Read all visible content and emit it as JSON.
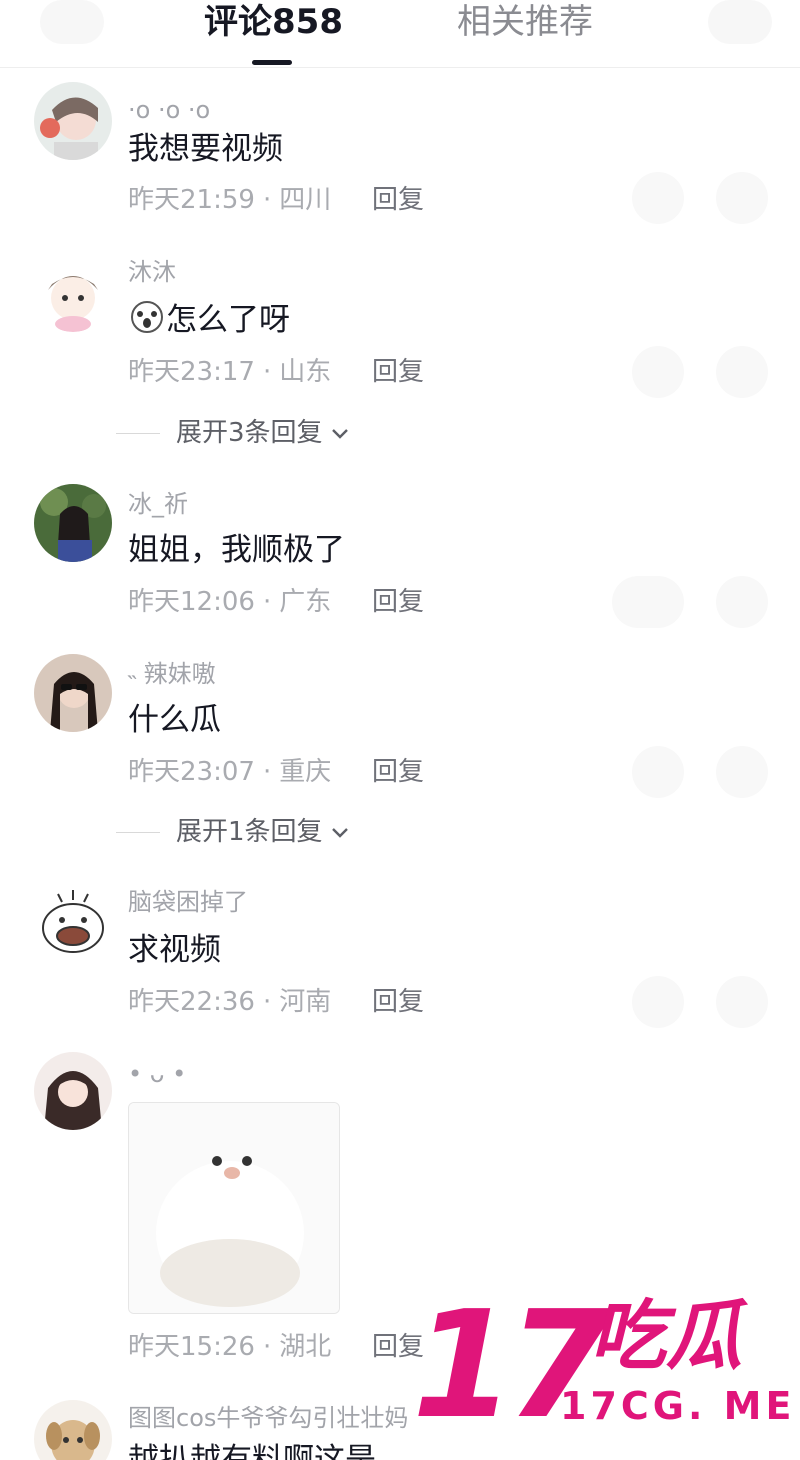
{
  "header": {
    "tabs": [
      {
        "label": "评论858",
        "active": true
      },
      {
        "label": "相关推荐",
        "active": false
      }
    ]
  },
  "comments": [
    {
      "username": "·o ·o ·o",
      "content": "我想要视频",
      "time": "昨天21:59",
      "location": "四川",
      "reply": "回复"
    },
    {
      "username": "沐沐",
      "content": "怎么了呀",
      "emoji_icon": "cute-face-emoji-icon",
      "time": "昨天23:17",
      "location": "山东",
      "reply": "回复",
      "expand": "展开3条回复"
    },
    {
      "username": "冰_祈",
      "content": "姐姐，我顺极了",
      "time": "昨天12:06",
      "location": "广东",
      "reply": "回复"
    },
    {
      "username": "˵ 辣妹嗷",
      "content": "什么瓜",
      "time": "昨天23:07",
      "location": "重庆",
      "reply": "回复",
      "expand": "展开1条回复"
    },
    {
      "username": "脑袋困掉了",
      "content": "求视频",
      "time": "昨天22:36",
      "location": "河南",
      "reply": "回复"
    },
    {
      "username": "• ᴗ •",
      "content": "",
      "sticker_icon": "white-bird-sticker-icon",
      "time": "昨天15:26",
      "location": "湖北",
      "reply": "回复"
    },
    {
      "username": "图图cos牛爷爷勾引壮壮妈",
      "content": "越扒越有料啊这是",
      "time": "",
      "location": "",
      "reply": ""
    }
  ],
  "meta_separator": "·",
  "watermark": {
    "number": "17",
    "chinese": "吃瓜",
    "url": "17CG. ME"
  },
  "colors": {
    "accent": "#e0157a",
    "text": "#161823",
    "muted": "#a9abb0"
  }
}
